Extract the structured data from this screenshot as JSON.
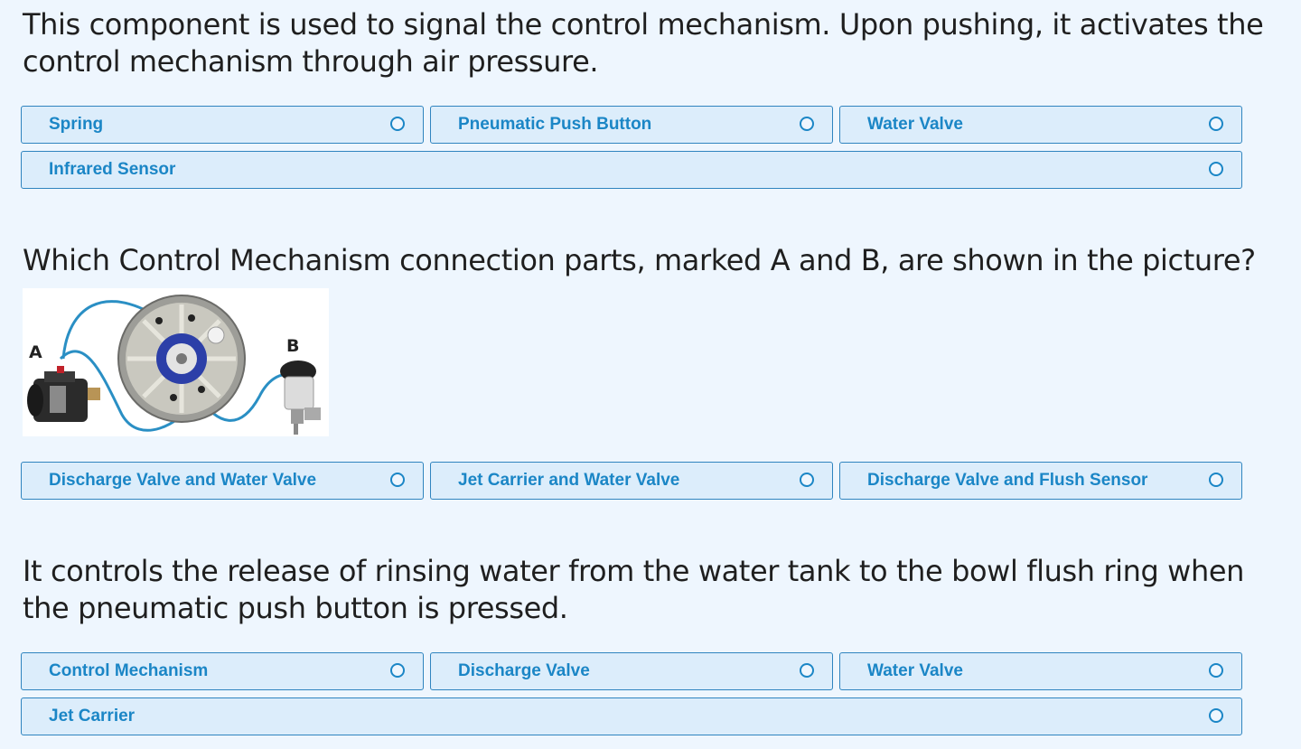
{
  "questions": [
    {
      "text": "This component is used to signal the control mechanism. Upon pushing, it activates the control mechanism through air pressure.",
      "options": [
        "Spring",
        "Pneumatic Push Button",
        "Water Valve",
        "Infrared Sensor"
      ]
    },
    {
      "text": "Which Control Mechanism connection parts, marked A and B, are shown in the picture?",
      "figure": {
        "label_a": "A",
        "label_b": "B"
      },
      "options": [
        "Discharge Valve and Water Valve",
        "Jet Carrier and Water Valve",
        "Discharge Valve and Flush Sensor"
      ]
    },
    {
      "text": "It controls the release of rinsing water from the water tank to the bowl flush ring when the pneumatic push button is pressed.",
      "options": [
        "Control Mechanism",
        "Discharge Valve",
        "Water Valve",
        "Jet Carrier"
      ]
    }
  ],
  "colors": {
    "background": "#eef6fe",
    "option_fill": "#dcedfb",
    "option_border": "#2f84bf",
    "accent": "#1b86c6",
    "tube": "#2a8fc4"
  }
}
